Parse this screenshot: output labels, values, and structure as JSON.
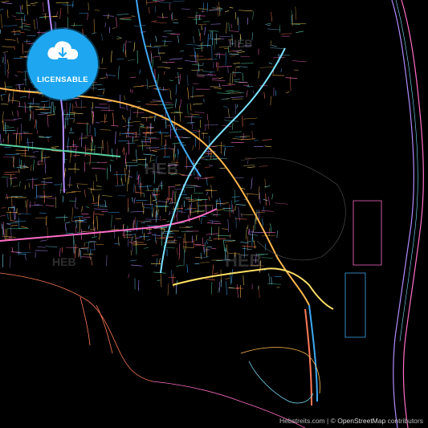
{
  "badge": {
    "label": "LICENSABLE",
    "color": "#1ea7f0",
    "icon": "cloud-download-icon"
  },
  "watermarks": [
    "HEB",
    "HEB",
    "HEB",
    "HEB"
  ],
  "attribution": {
    "source": "Hebstreits.com",
    "separator": " | © ",
    "osm": "OpenStreetMap",
    "suffix": " contributors"
  },
  "colors": {
    "background": "#000000",
    "roads": [
      "#3fa9f5",
      "#ff6ec7",
      "#ffb84d",
      "#7ce3ff",
      "#b18cff",
      "#ff7a59",
      "#ffe066",
      "#5ad1a0"
    ]
  }
}
